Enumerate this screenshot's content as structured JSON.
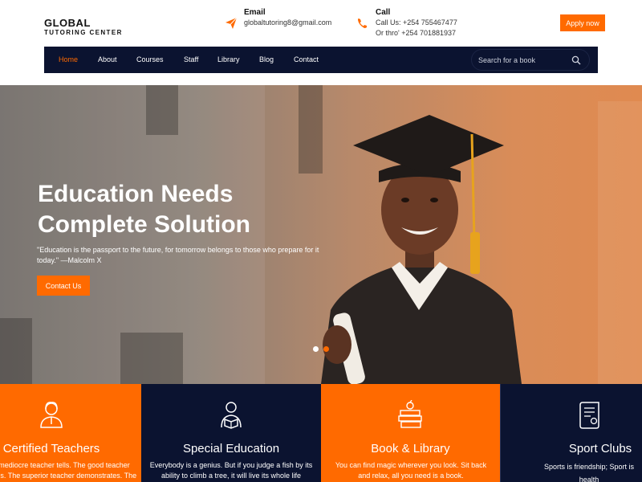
{
  "header": {
    "logo_line1": "GLOBAL",
    "logo_line2": "TUTORING CENTER",
    "email_title": "Email",
    "email_value": "globaltutoring8@gmail.com",
    "call_title": "Call",
    "call_line1": "Call Us: +254 755467477",
    "call_line2": "Or thro' +254 701881937",
    "apply_label": "Apply now"
  },
  "nav": {
    "items": [
      {
        "label": "Home"
      },
      {
        "label": "About"
      },
      {
        "label": "Courses"
      },
      {
        "label": "Staff"
      },
      {
        "label": "Library"
      },
      {
        "label": "Blog"
      },
      {
        "label": "Contact"
      }
    ],
    "search_placeholder": "Search for a book"
  },
  "hero": {
    "title_line1": "Education Needs",
    "title_line2": "Complete Solution",
    "quote": "\"Education is the passport to the future, for tomorrow belongs to those who prepare for it today.\" —Malcolm X",
    "button_label": "Contact Us"
  },
  "features": [
    {
      "title": "Certified Teachers",
      "desc": "The mediocre teacher tells. The good teacher explains. The superior teacher demonstrates. The"
    },
    {
      "title": "Special Education",
      "desc": "Everybody is a genius. But if you judge a fish by its ability to climb a tree, it will live its whole life"
    },
    {
      "title": "Book & Library",
      "desc": "You can find magic wherever you look. Sit back and relax, all you need is a book."
    },
    {
      "title": "Sport Clubs",
      "desc": "Sports is friendship; Sport is health"
    }
  ],
  "colors": {
    "accent": "#ff6a00",
    "navy": "#0b1330"
  }
}
